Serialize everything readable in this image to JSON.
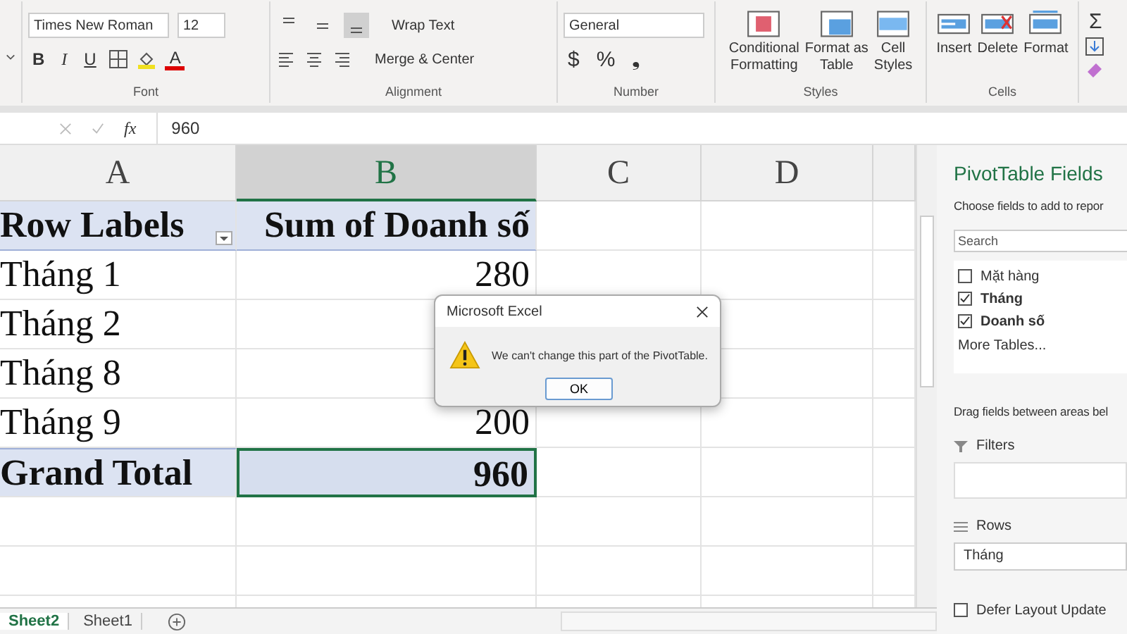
{
  "ribbon": {
    "font": {
      "name": "Times New Roman",
      "size": "12",
      "bold": "B",
      "italic": "I",
      "underline": "U",
      "color_letter": "A",
      "label": "Font"
    },
    "alignment": {
      "vertical": [
        {
          "selected": false
        },
        {
          "selected": false
        },
        {
          "selected": true
        }
      ],
      "wrap": "Wrap Text",
      "merge": "Merge & Center",
      "label": "Alignment"
    },
    "number": {
      "format": "General",
      "currency": "$",
      "percent": "%",
      "comma": "❟",
      "label": "Number"
    },
    "styles": {
      "buttons": [
        {
          "kind": "conditional",
          "line1": "Conditional",
          "line2": "Formatting"
        },
        {
          "kind": "table",
          "line1": "Format as",
          "line2": "Table"
        },
        {
          "kind": "cellstyles",
          "line1": "Cell",
          "line2": "Styles"
        }
      ],
      "label": "Styles"
    },
    "cells": {
      "buttons": [
        {
          "kind": "insert",
          "label": "Insert"
        },
        {
          "kind": "delete",
          "label": "Delete"
        },
        {
          "kind": "format",
          "label": "Format"
        }
      ],
      "label": "Cells"
    },
    "editing": {
      "sum": "Σ"
    }
  },
  "formula_bar": {
    "fx": "fx",
    "value": "960"
  },
  "sheet": {
    "columns": [
      {
        "label": "A",
        "selected": false
      },
      {
        "label": "B",
        "selected": true
      },
      {
        "label": "C",
        "selected": false
      },
      {
        "label": "D",
        "selected": false
      }
    ],
    "rows": [
      {
        "kind": "header",
        "label": "Row Labels",
        "value": "Sum of Doanh số"
      },
      {
        "kind": "item",
        "label": "Tháng 1",
        "value": "280"
      },
      {
        "kind": "item",
        "label": "Tháng 2",
        "value": ""
      },
      {
        "kind": "item",
        "label": "Tháng 8",
        "value": ""
      },
      {
        "kind": "item",
        "label": "Tháng 9",
        "value": "200"
      },
      {
        "kind": "total",
        "label": "Grand Total",
        "value": "960"
      }
    ]
  },
  "sheet_tabs": [
    {
      "label": "Sheet2",
      "selected": true
    },
    {
      "label": "Sheet1",
      "selected": false
    }
  ],
  "pivot_panel": {
    "title": "PivotTable Fields",
    "subtitle": "Choose fields to add to repor",
    "search": {
      "placeholder": "Search"
    },
    "fields": [
      {
        "label": "Mặt hàng",
        "checked": false
      },
      {
        "label": "Tháng",
        "checked": true
      },
      {
        "label": "Doanh số",
        "checked": true
      }
    ],
    "more_tables": "More Tables...",
    "drag_hint": "Drag fields between areas bel",
    "filters": "Filters",
    "rows_label": "Rows",
    "rows_value": "Tháng",
    "defer": {
      "label": "Defer Layout Update",
      "checked": false
    }
  },
  "dialog": {
    "title": "Microsoft Excel",
    "message": "We can't change this part of the PivotTable.",
    "button": "OK"
  }
}
